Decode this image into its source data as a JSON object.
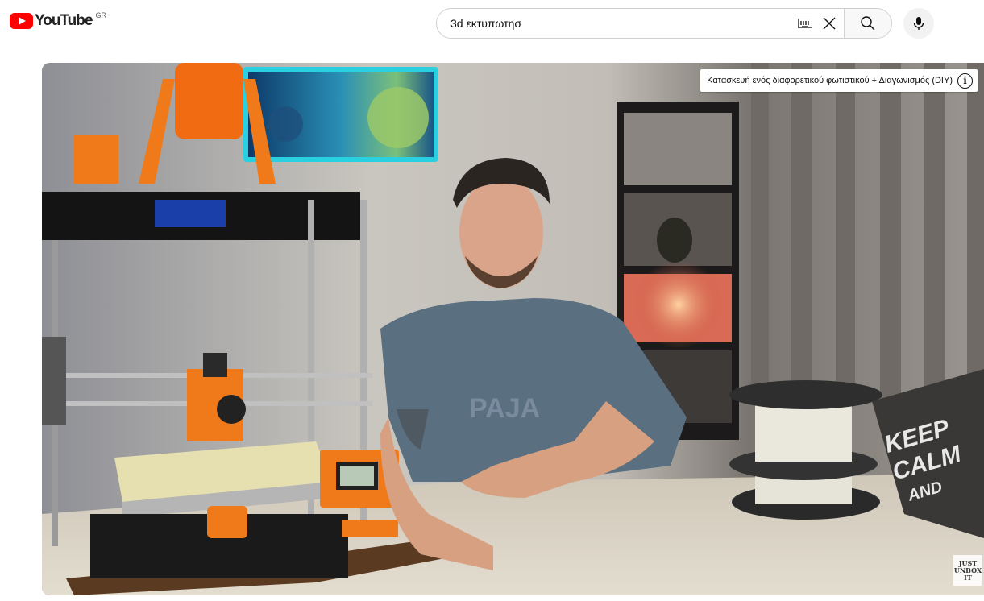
{
  "header": {
    "logo_text": "YouTube",
    "country_code": "GR",
    "search": {
      "value": "3d εκτυπωτησ"
    },
    "icons": [
      "youtube-logo-icon",
      "keyboard-icon",
      "close-icon",
      "search-icon",
      "mic-icon"
    ]
  },
  "video": {
    "info_card": {
      "title": "Κατασκευή ενός διαφορετικού φωτιστικού + Διαγωνισμός (DIY)",
      "icon": "i"
    },
    "watermark_lines": [
      "JUST",
      "UNBOX",
      "IT"
    ],
    "shirt_text": "PAJA",
    "pillow_text": [
      "KEEP",
      "CALM",
      "AND"
    ]
  },
  "colors": {
    "youtube_red": "#ff0000",
    "printer_orange": "#f07a1a",
    "shirt_blue": "#5a6f80"
  }
}
